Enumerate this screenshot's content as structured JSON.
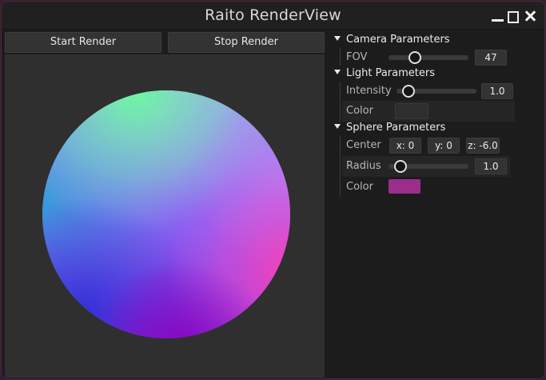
{
  "window": {
    "title": "Raito RenderView"
  },
  "toolbar": {
    "start_label": "Start Render",
    "stop_label": "Stop Render"
  },
  "panel": {
    "camera": {
      "header": "Camera Parameters",
      "fov_label": "FOV",
      "fov_value": "47",
      "fov_slider_fraction": 0.33
    },
    "light": {
      "header": "Light Parameters",
      "intensity_label": "Intensity",
      "intensity_value": "1.0",
      "intensity_slider_fraction": 0.15,
      "color_label": "Color",
      "color": "#2e2e2e"
    },
    "sphere": {
      "header": "Sphere Parameters",
      "center_label": "Center",
      "center_x": "x: 0",
      "center_y": "y: 0",
      "center_z": "z: -6.0",
      "radius_label": "Radius",
      "radius_value": "1.0",
      "radius_slider_fraction": 0.15,
      "color_label": "Color",
      "color": "#9a2e8a"
    }
  },
  "icons": [
    "minimize-icon",
    "maximize-icon",
    "close-icon",
    "collapse-triangle-icon"
  ]
}
